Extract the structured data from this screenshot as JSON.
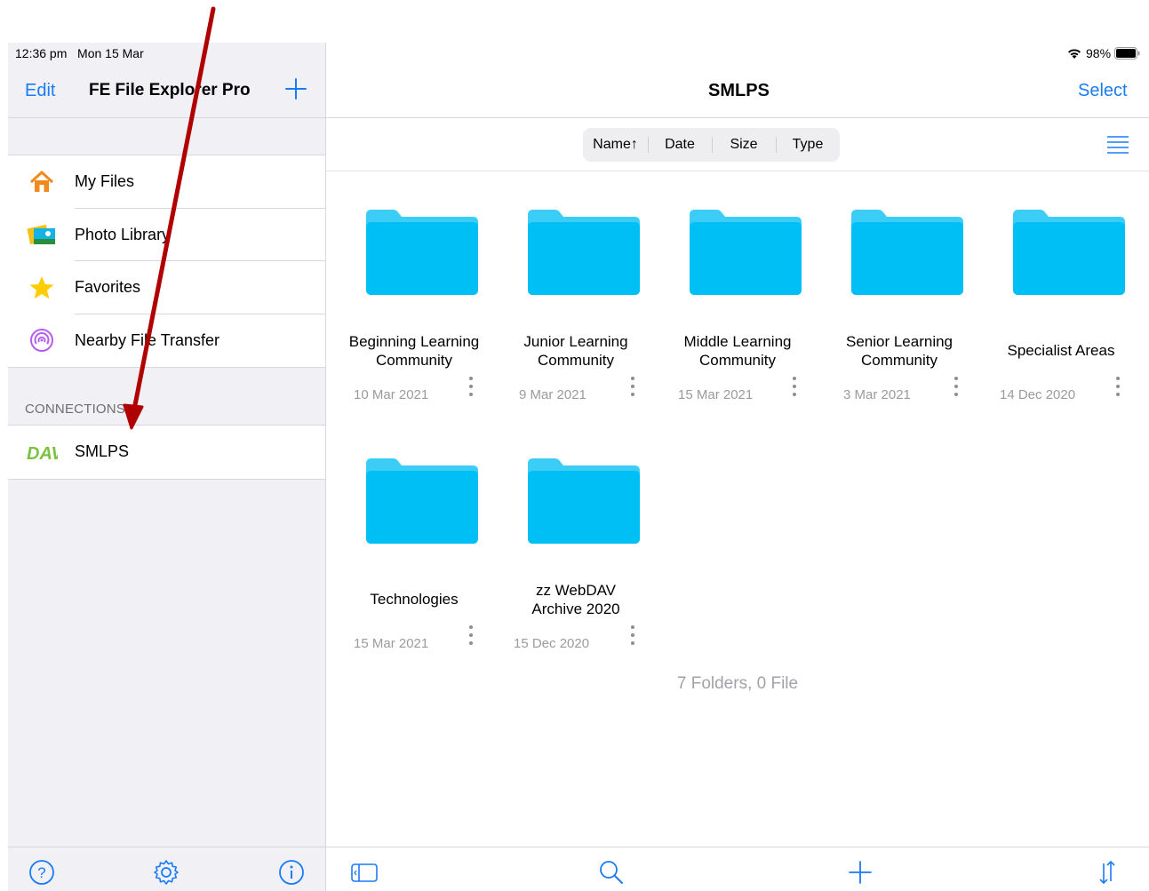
{
  "status_bar": {
    "time_date": "12:36 pm   Mon 15 Mar",
    "battery": "98%"
  },
  "sidebar": {
    "edit_label": "Edit",
    "title": "FE File Explorer Pro",
    "items": [
      {
        "label": "My Files",
        "icon": "home-icon"
      },
      {
        "label": "Photo Library",
        "icon": "photo-library-icon"
      },
      {
        "label": "Favorites",
        "icon": "star-icon"
      },
      {
        "label": "Nearby File Transfer",
        "icon": "nearby-transfer-icon"
      }
    ],
    "connections_label": "CONNECTIONS",
    "connections": [
      {
        "label": "SMLPS",
        "icon": "dav-icon"
      }
    ],
    "bottom_icons": [
      "help-icon",
      "settings-icon",
      "info-icon"
    ]
  },
  "main": {
    "title": "SMLPS",
    "select_label": "Select",
    "sort": [
      "Name↑",
      "Date",
      "Size",
      "Type"
    ],
    "folders": [
      {
        "name": "Beginning Learning Community",
        "date": "10 Mar 2021"
      },
      {
        "name": "Junior Learning Community",
        "date": "9 Mar 2021"
      },
      {
        "name": "Middle Learning Community",
        "date": "15 Mar 2021"
      },
      {
        "name": "Senior Learning Community",
        "date": "3 Mar 2021"
      },
      {
        "name": "Specialist Areas",
        "date": "14 Dec 2020"
      },
      {
        "name": "Technologies",
        "date": "15 Mar 2021"
      },
      {
        "name": "zz WebDAV Archive 2020",
        "date": "15 Dec 2020"
      }
    ],
    "summary": "7 Folders, 0 File",
    "toolbar_icons": [
      "sidebar-toggle-icon",
      "search-icon",
      "plus-icon",
      "sort-icon"
    ]
  },
  "colors": {
    "accent": "#1a7cf5",
    "folder": "#00bff5",
    "folder_tab": "#3ccdf7",
    "arrow": "#b00000"
  }
}
